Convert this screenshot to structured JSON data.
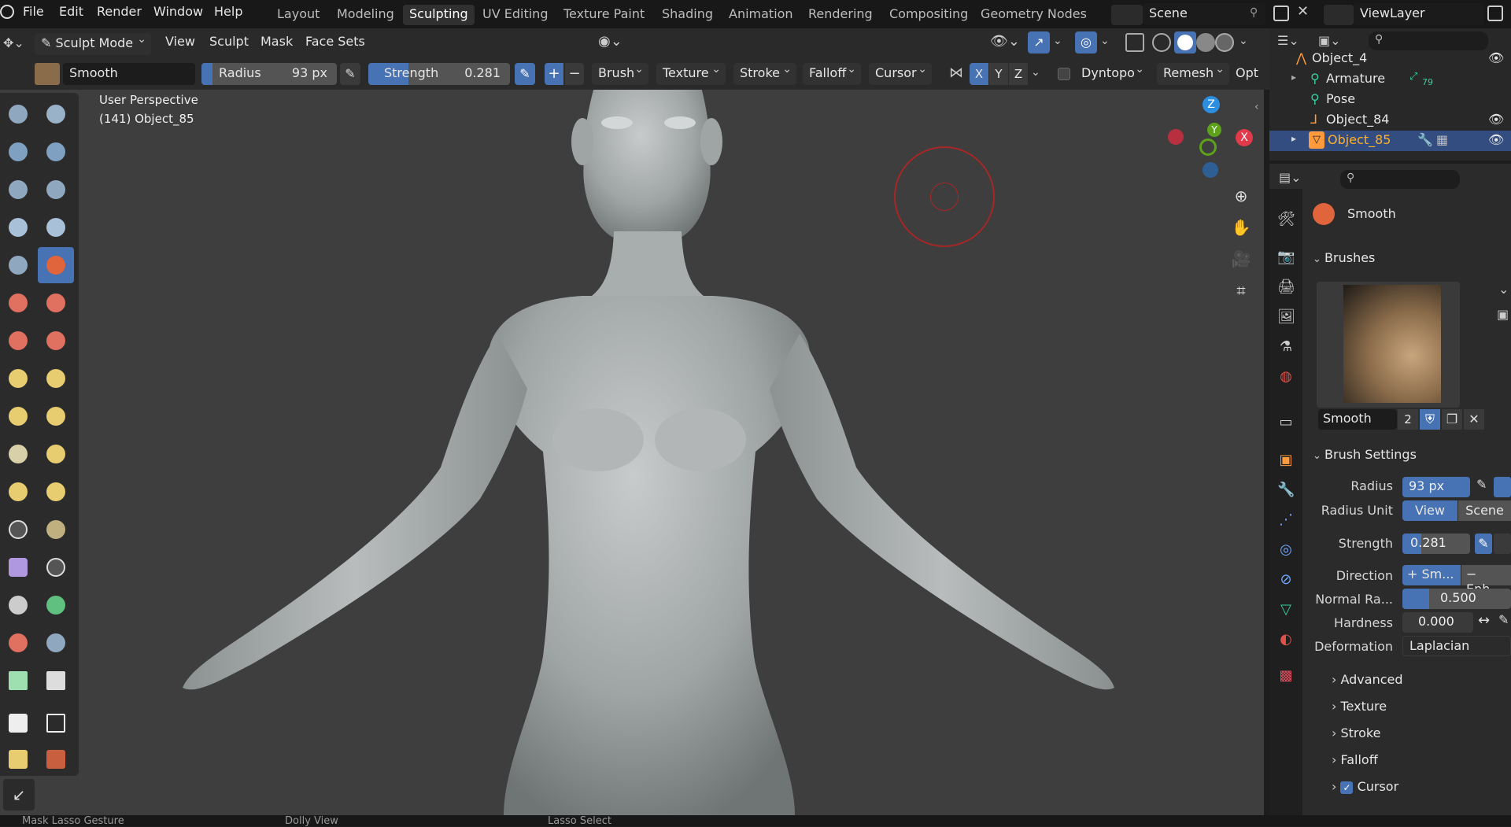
{
  "menu": {
    "items": [
      "File",
      "Edit",
      "Render",
      "Window",
      "Help"
    ]
  },
  "workspaces": [
    "Layout",
    "Modeling",
    "Sculpting",
    "UV Editing",
    "Texture Paint",
    "Shading",
    "Animation",
    "Rendering",
    "Compositing",
    "Geometry Nodes"
  ],
  "scene": {
    "label": "Scene",
    "view_layer": "ViewLayer"
  },
  "header": {
    "mode": "Sculpt Mode",
    "menus": [
      "View",
      "Sculpt",
      "Mask",
      "Face Sets"
    ]
  },
  "tool_header": {
    "brush_name": "Smooth",
    "radius_label": "Radius",
    "radius_value": "93 px",
    "strength_label": "Strength",
    "strength_value": "0.281",
    "dropdowns": [
      "Brush",
      "Texture",
      "Stroke",
      "Falloff",
      "Cursor"
    ],
    "axes": [
      "X",
      "Y",
      "Z"
    ],
    "dyntopo": "Dyntopo",
    "remesh": "Remesh",
    "opt": "Opt"
  },
  "viewport": {
    "perspective": "User Perspective",
    "object": "(141) Object_85",
    "gizmo": {
      "z": "Z",
      "y": "Y",
      "x": "X"
    }
  },
  "outliner": {
    "rows": [
      {
        "label": "Object_4"
      },
      {
        "label": "Armature",
        "badge": "79"
      },
      {
        "label": "Pose"
      },
      {
        "label": "Object_84"
      },
      {
        "label": "Object_85"
      }
    ]
  },
  "properties": {
    "brush_title": "Smooth",
    "brushes_section": "Brushes",
    "brush_name_field": "Smooth",
    "brush_users": "2",
    "brush_settings_section": "Brush Settings",
    "radius_label": "Radius",
    "radius_value": "93 px",
    "radius_unit_label": "Radius Unit",
    "radius_unit_view": "View",
    "radius_unit_scene": "Scene",
    "strength_label": "Strength",
    "strength_value": "0.281",
    "direction_label": "Direction",
    "direction_smooth": "+ Sm...",
    "direction_enhance": "− Enh...",
    "normal_radius_label": "Normal Ra...",
    "normal_radius_value": "0.500",
    "hardness_label": "Hardness",
    "hardness_value": "0.000",
    "deformation_label": "Deformation",
    "deformation_value": "Laplacian",
    "subsections": [
      "Advanced",
      "Texture",
      "Stroke",
      "Falloff",
      "Cursor"
    ]
  },
  "status": {
    "items": [
      "Mask Lasso Gesture",
      "Dolly View",
      "Lasso Select"
    ]
  },
  "colors": {
    "accent": "#4772b3",
    "selected_row": "#334d80",
    "active_text": "#ffaf29"
  }
}
